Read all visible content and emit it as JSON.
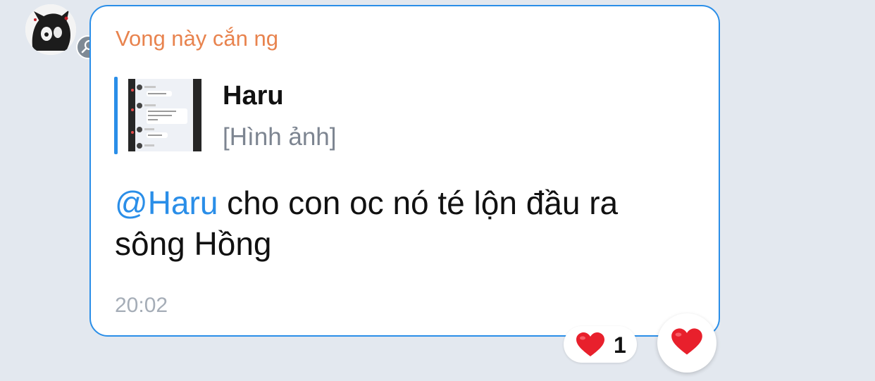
{
  "message": {
    "sender_name": "Vong này cắn ng",
    "reply_to": {
      "author": "Haru",
      "preview": "[Hình ảnh]"
    },
    "mention": "@Haru",
    "text_line1": " cho con oc nó té lộn đầu ra",
    "text_line2": "sông Hồng",
    "time": "20:02"
  },
  "reactions": [
    {
      "emoji": "heart",
      "count": "1"
    }
  ],
  "colors": {
    "background": "#e3e8ef",
    "bubble_border": "#2a8ee8",
    "sender_name": "#e8834e",
    "mention": "#2a8ee8",
    "heart": "#e8202c"
  },
  "icons": {
    "badge": "search-icon",
    "reaction": "heart-icon",
    "react_button": "heart-icon"
  }
}
